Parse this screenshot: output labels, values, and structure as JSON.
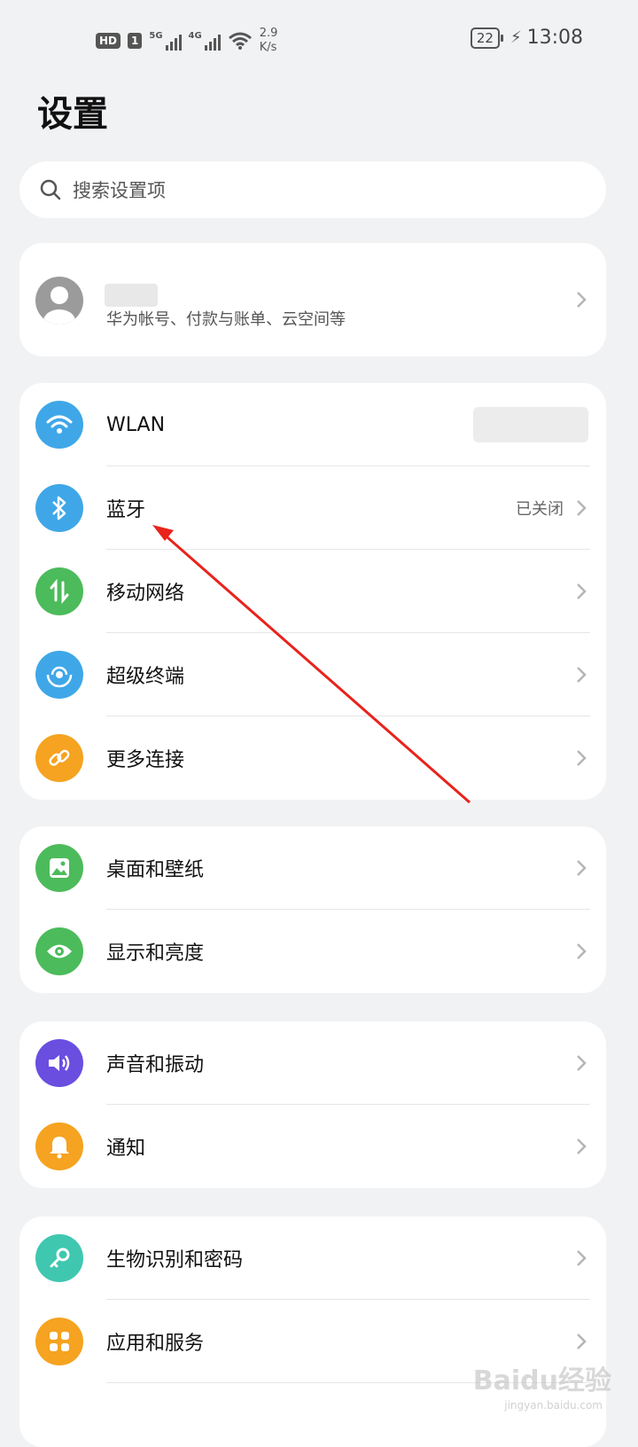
{
  "status_bar": {
    "hd": "HD",
    "sim": "1",
    "net1": "5G",
    "net2": "4G",
    "speed_value": "2.9",
    "speed_unit": "K/s",
    "battery": "22",
    "time": "13:08"
  },
  "title": "设置",
  "search": {
    "placeholder": "搜索设置项"
  },
  "account": {
    "subtitle": "华为帐号、付款与账单、云空间等"
  },
  "groups": [
    {
      "items": [
        {
          "label": "WLAN",
          "icon": "wifi-icon",
          "color": "#3fa7e8"
        },
        {
          "label": "蓝牙",
          "value": "已关闭",
          "icon": "bluetooth-icon",
          "color": "#3fa7e8"
        },
        {
          "label": "移动网络",
          "icon": "mobile-data-icon",
          "color": "#4cbb5b"
        },
        {
          "label": "超级终端",
          "icon": "super-device-icon",
          "color": "#3fa7e8"
        },
        {
          "label": "更多连接",
          "icon": "link-icon",
          "color": "#f5a320"
        }
      ]
    },
    {
      "items": [
        {
          "label": "桌面和壁纸",
          "icon": "wallpaper-icon",
          "color": "#4cbb5b"
        },
        {
          "label": "显示和亮度",
          "icon": "eye-icon",
          "color": "#4cbb5b"
        }
      ]
    },
    {
      "items": [
        {
          "label": "声音和振动",
          "icon": "speaker-icon",
          "color": "#6a4ee0"
        },
        {
          "label": "通知",
          "icon": "bell-icon",
          "color": "#f5a320"
        }
      ]
    },
    {
      "items": [
        {
          "label": "生物识别和密码",
          "icon": "key-icon",
          "color": "#3fc7b0"
        },
        {
          "label": "应用和服务",
          "icon": "apps-icon",
          "color": "#f5a320"
        }
      ]
    }
  ],
  "watermark": {
    "text": "Baidu经验",
    "sub": "jingyan.baidu.com"
  }
}
